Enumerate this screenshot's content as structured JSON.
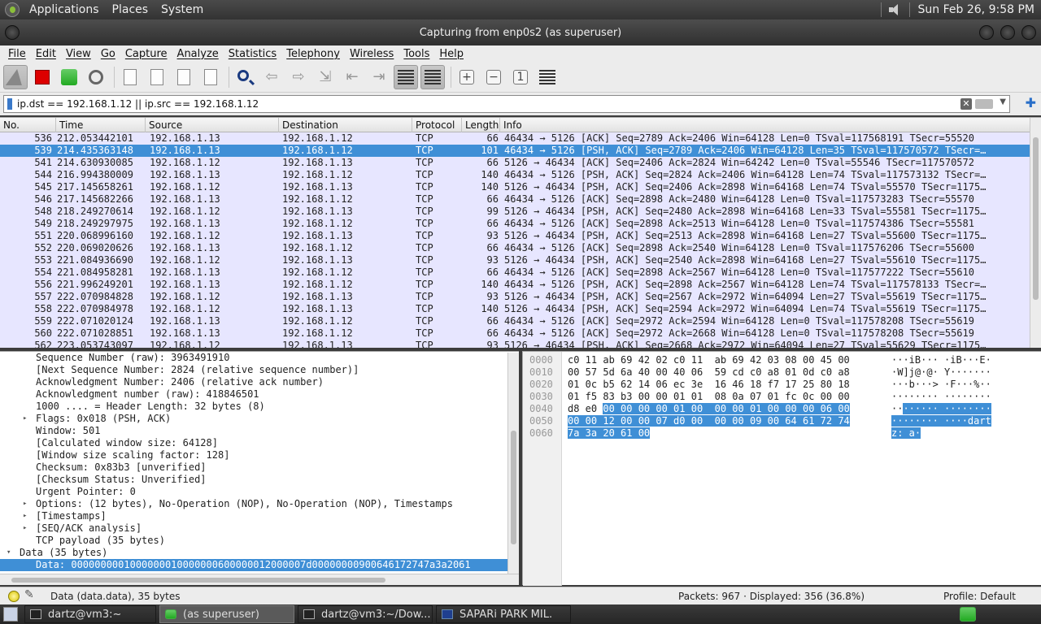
{
  "top_panel": {
    "menus": [
      "Applications",
      "Places",
      "System"
    ],
    "clock": "Sun Feb 26,  9:58 PM"
  },
  "window": {
    "title": "Capturing from enp0s2 (as superuser)"
  },
  "menubar": [
    "File",
    "Edit",
    "View",
    "Go",
    "Capture",
    "Analyze",
    "Statistics",
    "Telephony",
    "Wireless",
    "Tools",
    "Help"
  ],
  "toolbar": {
    "icons": [
      "shark-fin-start-icon",
      "stop-capture-icon",
      "restart-capture-icon",
      "capture-options-icon",
      "open-file-icon",
      "save-file-icon",
      "close-file-icon",
      "reload-file-icon",
      "find-packet-icon",
      "go-back-icon",
      "go-forward-icon",
      "go-to-packet-icon",
      "first-packet-icon",
      "last-packet-icon",
      "auto-scroll-icon",
      "colorize-icon",
      "zoom-in-icon",
      "zoom-out-icon",
      "normal-size-icon",
      "resize-columns-icon"
    ]
  },
  "filter": {
    "value": "ip.dst == 192.168.1.12 || ip.src == 192.168.1.12"
  },
  "packet_list": {
    "columns": [
      "No.",
      "Time",
      "Source",
      "Destination",
      "Protocol",
      "Length",
      "Info"
    ],
    "rows": [
      {
        "no": "536",
        "time": "212.053442101",
        "src": "192.168.1.13",
        "dst": "192.168.1.12",
        "proto": "TCP",
        "len": "66",
        "info": "46434 → 5126 [ACK] Seq=2789 Ack=2406 Win=64128 Len=0 TSval=117568191 TSecr=55520"
      },
      {
        "no": "539",
        "time": "214.435363148",
        "src": "192.168.1.13",
        "dst": "192.168.1.12",
        "proto": "TCP",
        "len": "101",
        "info": "46434 → 5126 [PSH, ACK] Seq=2789 Ack=2406 Win=64128 Len=35 TSval=117570572 TSecr=…"
      },
      {
        "no": "541",
        "time": "214.630930085",
        "src": "192.168.1.12",
        "dst": "192.168.1.13",
        "proto": "TCP",
        "len": "66",
        "info": "5126 → 46434 [ACK] Seq=2406 Ack=2824 Win=64242 Len=0 TSval=55546 TSecr=117570572"
      },
      {
        "no": "544",
        "time": "216.994380009",
        "src": "192.168.1.13",
        "dst": "192.168.1.12",
        "proto": "TCP",
        "len": "140",
        "info": "46434 → 5126 [PSH, ACK] Seq=2824 Ack=2406 Win=64128 Len=74 TSval=117573132 TSecr=…"
      },
      {
        "no": "545",
        "time": "217.145658261",
        "src": "192.168.1.12",
        "dst": "192.168.1.13",
        "proto": "TCP",
        "len": "140",
        "info": "5126 → 46434 [PSH, ACK] Seq=2406 Ack=2898 Win=64168 Len=74 TSval=55570 TSecr=1175…"
      },
      {
        "no": "546",
        "time": "217.145682266",
        "src": "192.168.1.13",
        "dst": "192.168.1.12",
        "proto": "TCP",
        "len": "66",
        "info": "46434 → 5126 [ACK] Seq=2898 Ack=2480 Win=64128 Len=0 TSval=117573283 TSecr=55570"
      },
      {
        "no": "548",
        "time": "218.249270614",
        "src": "192.168.1.12",
        "dst": "192.168.1.13",
        "proto": "TCP",
        "len": "99",
        "info": "5126 → 46434 [PSH, ACK] Seq=2480 Ack=2898 Win=64168 Len=33 TSval=55581 TSecr=1175…"
      },
      {
        "no": "549",
        "time": "218.249297975",
        "src": "192.168.1.13",
        "dst": "192.168.1.12",
        "proto": "TCP",
        "len": "66",
        "info": "46434 → 5126 [ACK] Seq=2898 Ack=2513 Win=64128 Len=0 TSval=117574386 TSecr=55581"
      },
      {
        "no": "551",
        "time": "220.068996160",
        "src": "192.168.1.12",
        "dst": "192.168.1.13",
        "proto": "TCP",
        "len": "93",
        "info": "5126 → 46434 [PSH, ACK] Seq=2513 Ack=2898 Win=64168 Len=27 TSval=55600 TSecr=1175…"
      },
      {
        "no": "552",
        "time": "220.069020626",
        "src": "192.168.1.13",
        "dst": "192.168.1.12",
        "proto": "TCP",
        "len": "66",
        "info": "46434 → 5126 [ACK] Seq=2898 Ack=2540 Win=64128 Len=0 TSval=117576206 TSecr=55600"
      },
      {
        "no": "553",
        "time": "221.084936690",
        "src": "192.168.1.12",
        "dst": "192.168.1.13",
        "proto": "TCP",
        "len": "93",
        "info": "5126 → 46434 [PSH, ACK] Seq=2540 Ack=2898 Win=64168 Len=27 TSval=55610 TSecr=1175…"
      },
      {
        "no": "554",
        "time": "221.084958281",
        "src": "192.168.1.13",
        "dst": "192.168.1.12",
        "proto": "TCP",
        "len": "66",
        "info": "46434 → 5126 [ACK] Seq=2898 Ack=2567 Win=64128 Len=0 TSval=117577222 TSecr=55610"
      },
      {
        "no": "556",
        "time": "221.996249201",
        "src": "192.168.1.13",
        "dst": "192.168.1.12",
        "proto": "TCP",
        "len": "140",
        "info": "46434 → 5126 [PSH, ACK] Seq=2898 Ack=2567 Win=64128 Len=74 TSval=117578133 TSecr=…"
      },
      {
        "no": "557",
        "time": "222.070984828",
        "src": "192.168.1.12",
        "dst": "192.168.1.13",
        "proto": "TCP",
        "len": "93",
        "info": "5126 → 46434 [PSH, ACK] Seq=2567 Ack=2972 Win=64094 Len=27 TSval=55619 TSecr=1175…"
      },
      {
        "no": "558",
        "time": "222.070984978",
        "src": "192.168.1.12",
        "dst": "192.168.1.13",
        "proto": "TCP",
        "len": "140",
        "info": "5126 → 46434 [PSH, ACK] Seq=2594 Ack=2972 Win=64094 Len=74 TSval=55619 TSecr=1175…"
      },
      {
        "no": "559",
        "time": "222.071020124",
        "src": "192.168.1.13",
        "dst": "192.168.1.12",
        "proto": "TCP",
        "len": "66",
        "info": "46434 → 5126 [ACK] Seq=2972 Ack=2594 Win=64128 Len=0 TSval=117578208 TSecr=55619"
      },
      {
        "no": "560",
        "time": "222.071028851",
        "src": "192.168.1.13",
        "dst": "192.168.1.12",
        "proto": "TCP",
        "len": "66",
        "info": "46434 → 5126 [ACK] Seq=2972 Ack=2668 Win=64128 Len=0 TSval=117578208 TSecr=55619"
      },
      {
        "no": "562",
        "time": "223.053743097",
        "src": "192.168.1.12",
        "dst": "192.168.1.13",
        "proto": "TCP",
        "len": "93",
        "info": "5126 → 46434 [PSH, ACK] Seq=2668 Ack=2972 Win=64094 Len=27 TSval=55629 TSecr=1175…"
      }
    ],
    "selected_no": "539"
  },
  "details": {
    "rows": [
      {
        "text": "Sequence Number (raw): 3963491910",
        "indent": 44,
        "expander": ""
      },
      {
        "text": "[Next Sequence Number: 2824    (relative sequence number)]",
        "indent": 44,
        "expander": ""
      },
      {
        "text": "Acknowledgment Number: 2406    (relative ack number)",
        "indent": 44,
        "expander": ""
      },
      {
        "text": "Acknowledgment number (raw): 418846501",
        "indent": 44,
        "expander": ""
      },
      {
        "text": "1000 .... = Header Length: 32 bytes (8)",
        "indent": 44,
        "expander": ""
      },
      {
        "text": "Flags: 0x018 (PSH, ACK)",
        "indent": 44,
        "expander": "▸"
      },
      {
        "text": "Window: 501",
        "indent": 44,
        "expander": ""
      },
      {
        "text": "[Calculated window size: 64128]",
        "indent": 44,
        "expander": ""
      },
      {
        "text": "[Window size scaling factor: 128]",
        "indent": 44,
        "expander": ""
      },
      {
        "text": "Checksum: 0x83b3 [unverified]",
        "indent": 44,
        "expander": ""
      },
      {
        "text": "[Checksum Status: Unverified]",
        "indent": 44,
        "expander": ""
      },
      {
        "text": "Urgent Pointer: 0",
        "indent": 44,
        "expander": ""
      },
      {
        "text": "Options: (12 bytes), No-Operation (NOP), No-Operation (NOP), Timestamps",
        "indent": 44,
        "expander": "▸"
      },
      {
        "text": "[Timestamps]",
        "indent": 44,
        "expander": "▸"
      },
      {
        "text": "[SEQ/ACK analysis]",
        "indent": 44,
        "expander": "▸"
      },
      {
        "text": "TCP payload (35 bytes)",
        "indent": 44,
        "expander": ""
      },
      {
        "text": "Data (35 bytes)",
        "indent": 24,
        "expander": "▾"
      },
      {
        "text": "Data: 0000000001000000010000000600000012000007d000000009006461727​47a3a2061",
        "indent": 44,
        "expander": "",
        "selected": true
      }
    ]
  },
  "bytes": {
    "rows": [
      {
        "off": "0000",
        "hex": "c0 11 ab 69 42 02 c0 11  ab 69 42 03 08 00 45 00",
        "ascii": "···iB··· ·iB···E·"
      },
      {
        "off": "0010",
        "hex": "00 57 5d 6a 40 00 40 06  59 cd c0 a8 01 0d c0 a8",
        "ascii": "·W]j@·@· Y·······"
      },
      {
        "off": "0020",
        "hex": "01 0c b5 62 14 06 ec 3e  16 46 18 f7 17 25 80 18",
        "ascii": "···b···> ·F···%··"
      },
      {
        "off": "0030",
        "hex": "01 f5 83 b3 00 00 01 01  08 0a 07 01 fc 0c 00 00",
        "ascii": "········ ········"
      },
      {
        "off": "0040",
        "hex_plain": "d8 e0 ",
        "hex_hl": "00 00 00 00 01 00  00 00 01 00 00 00 06 00",
        "ascii_plain": "··",
        "ascii_hl": "······ ········"
      },
      {
        "off": "0050",
        "hex_plain": "",
        "hex_hl": "00 00 12 00 00 07 d0 00  00 00 09 00 64 61 72 74",
        "ascii_plain": "",
        "ascii_hl": "········ ····dart"
      },
      {
        "off": "0060",
        "hex_plain": "",
        "hex_hl": "7a 3a 20 61 00",
        "ascii_plain": "",
        "ascii_hl": "z: a·"
      }
    ]
  },
  "status": {
    "field": "Data (data.data), 35 bytes",
    "packets": "Packets: 967 · Displayed: 356 (36.8%)",
    "profile": "Profile: Default"
  },
  "taskbar": {
    "tasks": [
      {
        "label": "dartz@vm3:~",
        "icon": "terminal-icon"
      },
      {
        "label": "(as superuser)",
        "icon": "wireshark-icon",
        "active": true
      },
      {
        "label": "dartz@vm3:~/Dow...",
        "icon": "terminal-icon"
      },
      {
        "label": "SAPARi PARK MIL.",
        "icon": "app-icon"
      }
    ]
  }
}
